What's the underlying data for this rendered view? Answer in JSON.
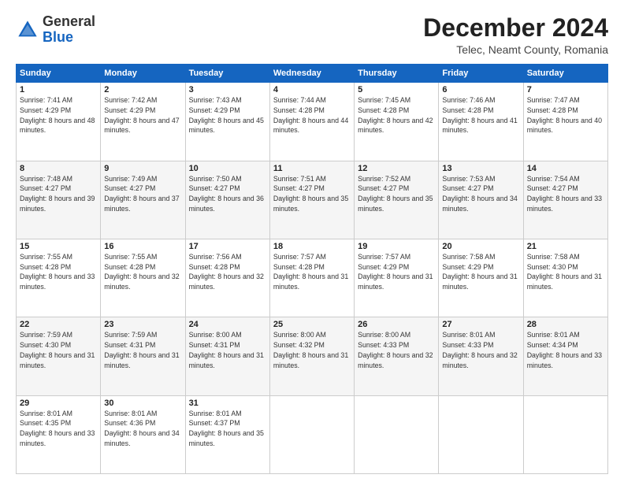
{
  "header": {
    "logo_line1": "General",
    "logo_line2": "Blue",
    "month": "December 2024",
    "location": "Telec, Neamt County, Romania"
  },
  "days_of_week": [
    "Sunday",
    "Monday",
    "Tuesday",
    "Wednesday",
    "Thursday",
    "Friday",
    "Saturday"
  ],
  "weeks": [
    [
      {
        "day": "1",
        "sunrise": "7:41 AM",
        "sunset": "4:29 PM",
        "daylight": "8 hours and 48 minutes."
      },
      {
        "day": "2",
        "sunrise": "7:42 AM",
        "sunset": "4:29 PM",
        "daylight": "8 hours and 47 minutes."
      },
      {
        "day": "3",
        "sunrise": "7:43 AM",
        "sunset": "4:29 PM",
        "daylight": "8 hours and 45 minutes."
      },
      {
        "day": "4",
        "sunrise": "7:44 AM",
        "sunset": "4:28 PM",
        "daylight": "8 hours and 44 minutes."
      },
      {
        "day": "5",
        "sunrise": "7:45 AM",
        "sunset": "4:28 PM",
        "daylight": "8 hours and 42 minutes."
      },
      {
        "day": "6",
        "sunrise": "7:46 AM",
        "sunset": "4:28 PM",
        "daylight": "8 hours and 41 minutes."
      },
      {
        "day": "7",
        "sunrise": "7:47 AM",
        "sunset": "4:28 PM",
        "daylight": "8 hours and 40 minutes."
      }
    ],
    [
      {
        "day": "8",
        "sunrise": "7:48 AM",
        "sunset": "4:27 PM",
        "daylight": "8 hours and 39 minutes."
      },
      {
        "day": "9",
        "sunrise": "7:49 AM",
        "sunset": "4:27 PM",
        "daylight": "8 hours and 37 minutes."
      },
      {
        "day": "10",
        "sunrise": "7:50 AM",
        "sunset": "4:27 PM",
        "daylight": "8 hours and 36 minutes."
      },
      {
        "day": "11",
        "sunrise": "7:51 AM",
        "sunset": "4:27 PM",
        "daylight": "8 hours and 35 minutes."
      },
      {
        "day": "12",
        "sunrise": "7:52 AM",
        "sunset": "4:27 PM",
        "daylight": "8 hours and 35 minutes."
      },
      {
        "day": "13",
        "sunrise": "7:53 AM",
        "sunset": "4:27 PM",
        "daylight": "8 hours and 34 minutes."
      },
      {
        "day": "14",
        "sunrise": "7:54 AM",
        "sunset": "4:27 PM",
        "daylight": "8 hours and 33 minutes."
      }
    ],
    [
      {
        "day": "15",
        "sunrise": "7:55 AM",
        "sunset": "4:28 PM",
        "daylight": "8 hours and 33 minutes."
      },
      {
        "day": "16",
        "sunrise": "7:55 AM",
        "sunset": "4:28 PM",
        "daylight": "8 hours and 32 minutes."
      },
      {
        "day": "17",
        "sunrise": "7:56 AM",
        "sunset": "4:28 PM",
        "daylight": "8 hours and 32 minutes."
      },
      {
        "day": "18",
        "sunrise": "7:57 AM",
        "sunset": "4:28 PM",
        "daylight": "8 hours and 31 minutes."
      },
      {
        "day": "19",
        "sunrise": "7:57 AM",
        "sunset": "4:29 PM",
        "daylight": "8 hours and 31 minutes."
      },
      {
        "day": "20",
        "sunrise": "7:58 AM",
        "sunset": "4:29 PM",
        "daylight": "8 hours and 31 minutes."
      },
      {
        "day": "21",
        "sunrise": "7:58 AM",
        "sunset": "4:30 PM",
        "daylight": "8 hours and 31 minutes."
      }
    ],
    [
      {
        "day": "22",
        "sunrise": "7:59 AM",
        "sunset": "4:30 PM",
        "daylight": "8 hours and 31 minutes."
      },
      {
        "day": "23",
        "sunrise": "7:59 AM",
        "sunset": "4:31 PM",
        "daylight": "8 hours and 31 minutes."
      },
      {
        "day": "24",
        "sunrise": "8:00 AM",
        "sunset": "4:31 PM",
        "daylight": "8 hours and 31 minutes."
      },
      {
        "day": "25",
        "sunrise": "8:00 AM",
        "sunset": "4:32 PM",
        "daylight": "8 hours and 31 minutes."
      },
      {
        "day": "26",
        "sunrise": "8:00 AM",
        "sunset": "4:33 PM",
        "daylight": "8 hours and 32 minutes."
      },
      {
        "day": "27",
        "sunrise": "8:01 AM",
        "sunset": "4:33 PM",
        "daylight": "8 hours and 32 minutes."
      },
      {
        "day": "28",
        "sunrise": "8:01 AM",
        "sunset": "4:34 PM",
        "daylight": "8 hours and 33 minutes."
      }
    ],
    [
      {
        "day": "29",
        "sunrise": "8:01 AM",
        "sunset": "4:35 PM",
        "daylight": "8 hours and 33 minutes."
      },
      {
        "day": "30",
        "sunrise": "8:01 AM",
        "sunset": "4:36 PM",
        "daylight": "8 hours and 34 minutes."
      },
      {
        "day": "31",
        "sunrise": "8:01 AM",
        "sunset": "4:37 PM",
        "daylight": "8 hours and 35 minutes."
      },
      null,
      null,
      null,
      null
    ]
  ],
  "labels": {
    "sunrise": "Sunrise:",
    "sunset": "Sunset:",
    "daylight": "Daylight:"
  }
}
